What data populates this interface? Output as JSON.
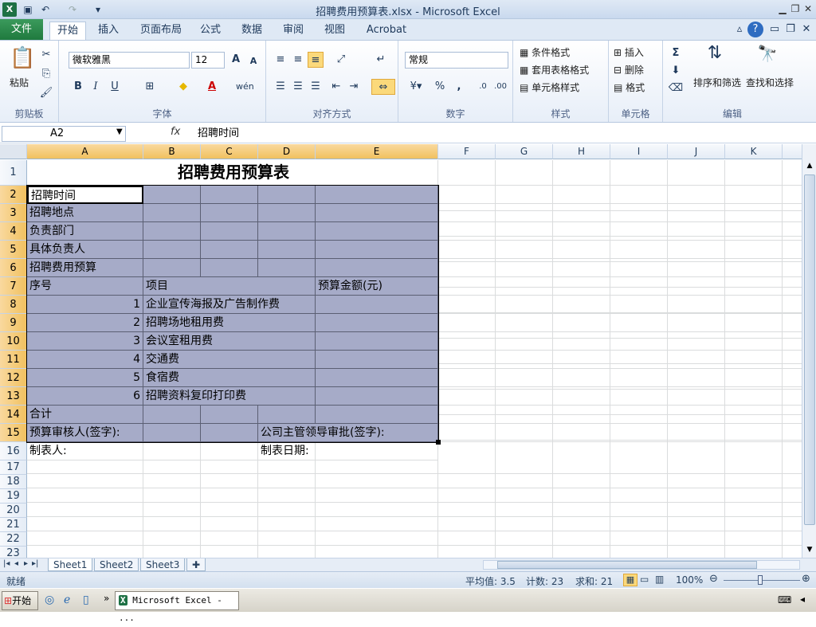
{
  "window": {
    "title": "招聘费用预算表.xlsx - Microsoft Excel"
  },
  "tabs": [
    "文件",
    "开始",
    "插入",
    "页面布局",
    "公式",
    "数据",
    "审阅",
    "视图",
    "Acrobat"
  ],
  "ribbon": {
    "clipboard": {
      "paste": "粘贴",
      "group": "剪贴板"
    },
    "font": {
      "name": "微软雅黑",
      "size": "12",
      "group": "字体",
      "bold": "B",
      "italic": "I",
      "underline": "U"
    },
    "alignment": {
      "group": "对齐方式"
    },
    "number": {
      "format": "常规",
      "group": "数字",
      "percent": "%",
      "comma": ","
    },
    "styles": {
      "cond": "条件格式",
      "table": "套用表格格式",
      "cell": "单元格样式",
      "group": "样式"
    },
    "cells": {
      "insert": "插入",
      "delete": "删除",
      "format": "格式",
      "group": "单元格"
    },
    "editing": {
      "sum": "Σ",
      "sort": "排序和筛选",
      "find": "查找和选择",
      "group": "编辑"
    }
  },
  "formula_bar": {
    "name_box": "A2",
    "fx": "fx",
    "content": "招聘时间"
  },
  "columns": [
    "A",
    "B",
    "C",
    "D",
    "E",
    "F",
    "G",
    "H",
    "I",
    "J",
    "K"
  ],
  "rows": [
    "1",
    "2",
    "3",
    "4",
    "5",
    "6",
    "7",
    "8",
    "9",
    "10",
    "11",
    "12",
    "13",
    "14",
    "15",
    "16",
    "17",
    "18",
    "19",
    "20",
    "21",
    "22",
    "23"
  ],
  "sheet": {
    "title": "招聘费用预算表",
    "labels": [
      "招聘时间",
      "招聘地点",
      "负责部门",
      "具体负责人",
      "招聘费用预算"
    ],
    "header": {
      "no": "序号",
      "item": "项目",
      "amount": "预算金额(元)"
    },
    "items": [
      {
        "no": "1",
        "name": "企业宣传海报及广告制作费"
      },
      {
        "no": "2",
        "name": "招聘场地租用费"
      },
      {
        "no": "3",
        "name": "会议室租用费"
      },
      {
        "no": "4",
        "name": "交通费"
      },
      {
        "no": "5",
        "name": "食宿费"
      },
      {
        "no": "6",
        "name": "招聘资料复印打印费"
      }
    ],
    "total": "合计",
    "reviewer": "预算审核人(签字):",
    "approver": "公司主管领导审批(签字):",
    "maker": "制表人:",
    "date": "制表日期:"
  },
  "sheets": [
    "Sheet1",
    "Sheet2",
    "Sheet3"
  ],
  "status": {
    "ready": "就绪",
    "average": "平均值: 3.5",
    "count": "计数: 23",
    "sum": "求和: 21",
    "zoom": "100%"
  },
  "taskbar": {
    "start": "开始",
    "app": "Microsoft Excel - ..."
  },
  "colors": {
    "accent_fill": "#a6abc8",
    "file_tab": "#1f7a3e",
    "selected_header": "#f1c15f"
  }
}
